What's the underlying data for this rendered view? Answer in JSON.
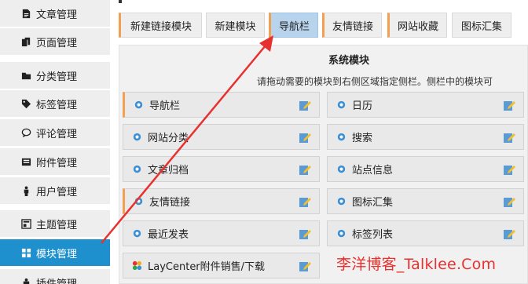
{
  "sidebar": {
    "items": [
      {
        "label": "文章管理",
        "icon": "file-icon"
      },
      {
        "label": "页面管理",
        "icon": "page-icon"
      },
      {
        "label": "分类管理",
        "icon": "folder-icon"
      },
      {
        "label": "标签管理",
        "icon": "tag-icon"
      },
      {
        "label": "评论管理",
        "icon": "comment-icon"
      },
      {
        "label": "附件管理",
        "icon": "attachment-icon"
      },
      {
        "label": "用户管理",
        "icon": "user-icon"
      },
      {
        "label": "主题管理",
        "icon": "theme-icon"
      },
      {
        "label": "模块管理",
        "icon": "module-icon",
        "active": true
      },
      {
        "label": "插件管理",
        "icon": "plugin-icon"
      }
    ]
  },
  "tabs": [
    {
      "label": "新建链接模块"
    },
    {
      "label": "新建模块"
    },
    {
      "label": "导航栏",
      "active": true
    },
    {
      "label": "友情链接"
    },
    {
      "label": "网站收藏"
    },
    {
      "label": "图标汇集"
    }
  ],
  "panel": {
    "title": "系统模块",
    "hint": "请拖动需要的模块到右侧区域指定侧栏。侧栏中的模块可"
  },
  "modules": [
    {
      "label": "导航栏"
    },
    {
      "label": "日历"
    },
    {
      "label": "网站分类"
    },
    {
      "label": "搜索"
    },
    {
      "label": "文章归档"
    },
    {
      "label": "站点信息"
    },
    {
      "label": "友情链接"
    },
    {
      "label": "图标汇集"
    },
    {
      "label": "最近发表"
    },
    {
      "label": "标签列表"
    },
    {
      "label": "LayCenter附件销售/下载"
    }
  ],
  "watermark": "李洋博客_Talklee.Com",
  "colors": {
    "accent_blue": "#1e90ce",
    "tab_highlight": "#f0a050",
    "arrow_red": "#e8312f"
  }
}
